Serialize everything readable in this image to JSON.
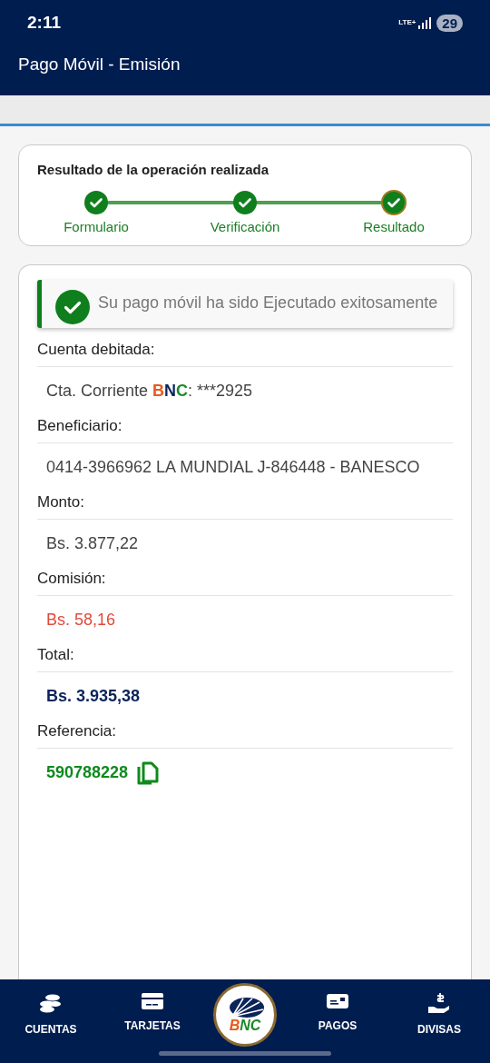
{
  "status_bar": {
    "time": "2:11",
    "network": "LTE+",
    "battery": "29"
  },
  "header": {
    "title": "Pago Móvil - Emisión"
  },
  "progress": {
    "title": "Resultado de la operación realizada",
    "steps": [
      {
        "label": "Formulario",
        "done": true,
        "selected": false
      },
      {
        "label": "Verificación",
        "done": true,
        "selected": false
      },
      {
        "label": "Resultado",
        "done": true,
        "selected": true
      }
    ]
  },
  "alert": {
    "message": "Su pago móvil ha sido Ejecutado exitosamente"
  },
  "details": [
    {
      "label": "Cuenta debitada:",
      "kind": "account",
      "prefix": "Cta. Corriente ",
      "brand": [
        {
          "text": "B",
          "color": "#e8591c"
        },
        {
          "text": "N",
          "color": "#0b2459"
        },
        {
          "text": "C",
          "color": "#1c8a2a"
        }
      ],
      "suffix": ": ***2925"
    },
    {
      "label": "Beneficiario:",
      "kind": "plain",
      "value": "0414-3966962 LA MUNDIAL J-846448 - BANESCO"
    },
    {
      "label": "Monto:",
      "kind": "plain",
      "value": "Bs. 3.877,22"
    },
    {
      "label": "Comisión:",
      "kind": "negative",
      "value": "Bs. 58,16"
    },
    {
      "label": "Total:",
      "kind": "total",
      "value": "Bs. 3.935,38"
    },
    {
      "label": "Referencia:",
      "kind": "reference",
      "value": "590788228"
    }
  ],
  "nav": {
    "items": [
      {
        "label": "CUENTAS"
      },
      {
        "label": "TARJETAS"
      },
      {
        "label": "PAGOS"
      },
      {
        "label": "DIVISAS"
      }
    ],
    "logo": [
      {
        "text": "B",
        "color": "#e8591c"
      },
      {
        "text": "N",
        "color": "#1c8a2a"
      },
      {
        "text": "C",
        "color": "#1c8a2a"
      }
    ]
  }
}
